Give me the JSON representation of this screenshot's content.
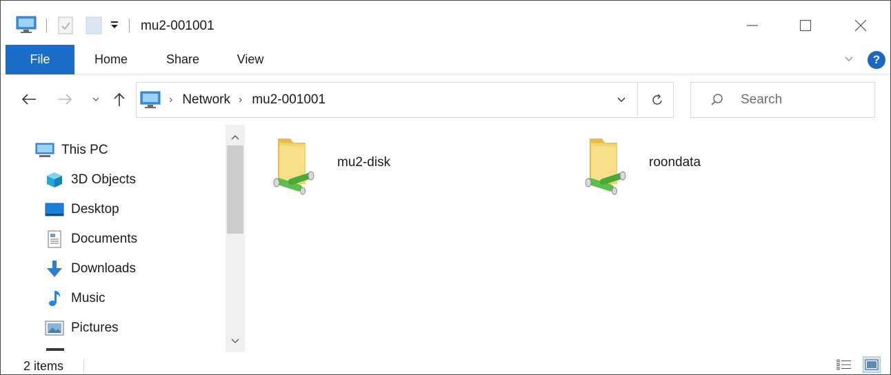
{
  "window": {
    "title": "mu2-001001"
  },
  "ribbon": {
    "tabs": [
      "File",
      "Home",
      "Share",
      "View"
    ]
  },
  "navbar": {
    "breadcrumbs": [
      "Network",
      "mu2-001001"
    ],
    "search_placeholder": "Search"
  },
  "sidebar": {
    "items": [
      {
        "label": "This PC",
        "icon": "pc-icon"
      },
      {
        "label": "3D Objects",
        "icon": "cube-icon"
      },
      {
        "label": "Desktop",
        "icon": "desktop-icon"
      },
      {
        "label": "Documents",
        "icon": "document-icon"
      },
      {
        "label": "Downloads",
        "icon": "download-arrow-icon"
      },
      {
        "label": "Music",
        "icon": "music-note-icon"
      },
      {
        "label": "Pictures",
        "icon": "picture-icon"
      }
    ]
  },
  "content": {
    "shares": [
      {
        "name": "mu2-disk",
        "icon": "network-folder-icon"
      },
      {
        "name": "roondata",
        "icon": "network-folder-icon"
      }
    ]
  },
  "status": {
    "item_count": "2 items"
  },
  "colors": {
    "file_tab": "#1a6ec7",
    "folder": "#f2cf63",
    "network_pipe": "#55b348"
  }
}
